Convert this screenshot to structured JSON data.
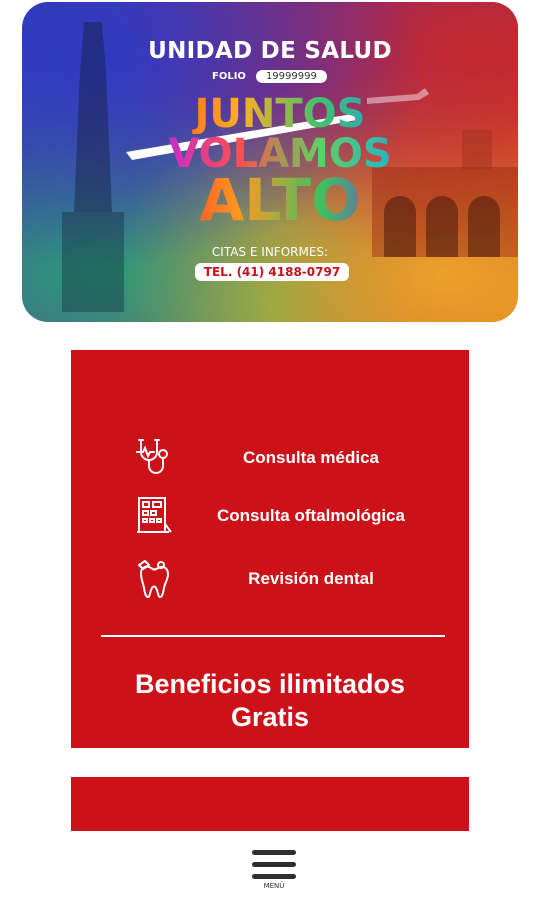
{
  "card": {
    "title": "UNIDAD DE SALUD",
    "folio_label": "FOLIO",
    "folio_value": "19999999",
    "headline": [
      "JUNTOS",
      "VOLAMOS",
      "ALTO"
    ],
    "citas_label": "CITAS E INFORMES:",
    "phone": "TEL. (41) 4188-0797"
  },
  "services": [
    {
      "label": "Consulta médica",
      "icon": "stethoscope-icon"
    },
    {
      "label": "Consulta oftalmológica",
      "icon": "eye-chart-icon"
    },
    {
      "label": "Revisión dental",
      "icon": "tooth-icon"
    }
  ],
  "benefits": {
    "line1": "Beneficios ilimitados",
    "line2": "Gratis"
  },
  "menu": {
    "label": "MENÚ",
    "icon": "hamburger-menu-icon"
  },
  "colors": {
    "primary_red": "#cc1119",
    "white": "#ffffff"
  }
}
